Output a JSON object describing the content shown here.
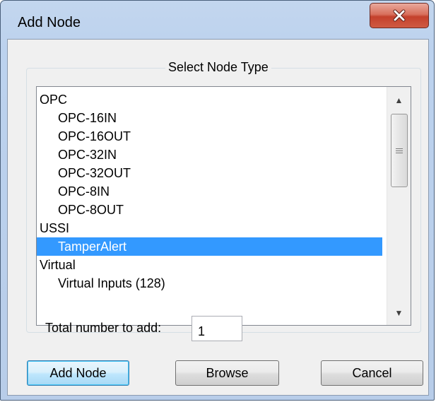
{
  "window": {
    "title": "Add Node"
  },
  "group": {
    "label": "Select Node Type"
  },
  "list": {
    "items": [
      {
        "label": "OPC",
        "level": 0,
        "selected": false
      },
      {
        "label": "OPC-16IN",
        "level": 1,
        "selected": false
      },
      {
        "label": "OPC-16OUT",
        "level": 1,
        "selected": false
      },
      {
        "label": "OPC-32IN",
        "level": 1,
        "selected": false
      },
      {
        "label": "OPC-32OUT",
        "level": 1,
        "selected": false
      },
      {
        "label": "OPC-8IN",
        "level": 1,
        "selected": false
      },
      {
        "label": "OPC-8OUT",
        "level": 1,
        "selected": false
      },
      {
        "label": "USSI",
        "level": 0,
        "selected": false
      },
      {
        "label": "TamperAlert",
        "level": 1,
        "selected": true
      },
      {
        "label": "Virtual",
        "level": 0,
        "selected": false
      },
      {
        "label": "Virtual Inputs (128)",
        "level": 1,
        "selected": false
      }
    ],
    "selection_color": "#3399ff"
  },
  "total": {
    "label": "Total number to add:",
    "value": "1"
  },
  "buttons": {
    "add": "Add Node",
    "browse": "Browse",
    "cancel": "Cancel"
  },
  "icons": {
    "close": "close-x-icon",
    "scroll_up": "triangle-up-icon",
    "scroll_down": "triangle-down-icon"
  }
}
